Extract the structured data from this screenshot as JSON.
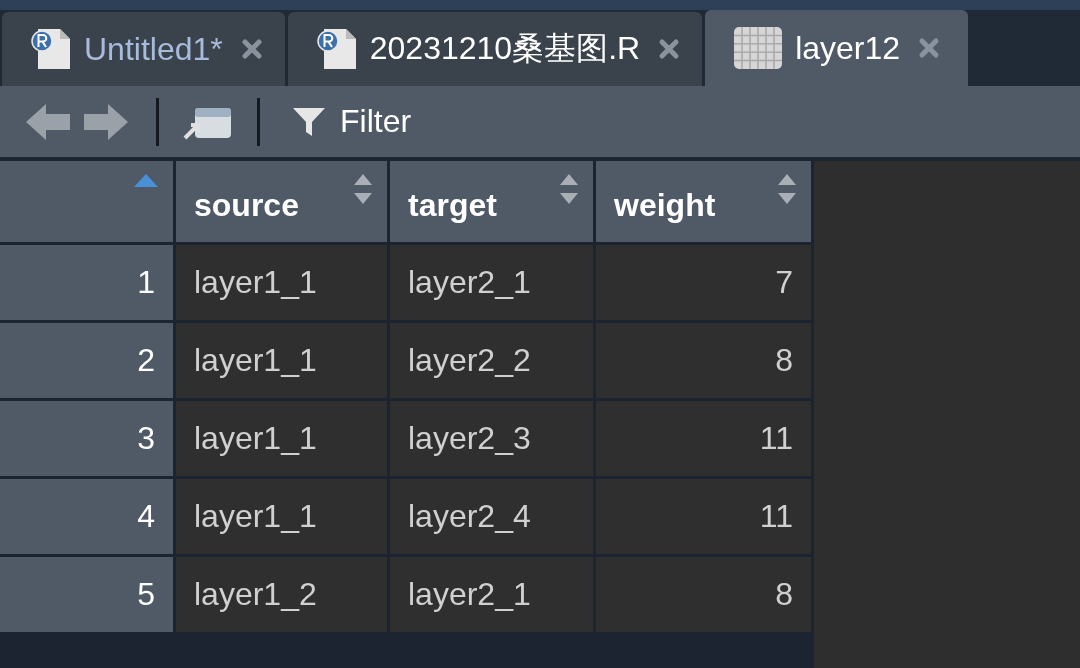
{
  "tabs": [
    {
      "kind": "script",
      "label": "Untitled1*",
      "unsaved": true,
      "selected": false
    },
    {
      "kind": "script",
      "label": "20231210桑基图.R",
      "unsaved": false,
      "selected": false
    },
    {
      "kind": "data",
      "label": "layer12",
      "unsaved": false,
      "selected": true
    }
  ],
  "toolbar": {
    "back": {
      "disabled": true
    },
    "forward": {
      "disabled": true
    },
    "filter": {
      "label": "Filter"
    }
  },
  "table": {
    "columns": [
      {
        "kind": "number",
        "sorted": true
      },
      {
        "kind": "text",
        "label": "source",
        "sorted": false
      },
      {
        "kind": "text",
        "label": "target",
        "sorted": false
      },
      {
        "kind": "number",
        "label": "weight",
        "sorted": false
      }
    ],
    "rows": [
      [
        "1",
        "layer1_1",
        "layer2_1",
        "7"
      ],
      [
        "2",
        "layer1_1",
        "layer2_2",
        "8"
      ],
      [
        "3",
        "layer1_1",
        "layer2_3",
        "11"
      ],
      [
        "4",
        "layer1_1",
        "layer2_4",
        "11"
      ],
      [
        "5",
        "layer1_2",
        "layer2_1",
        "8"
      ]
    ]
  }
}
